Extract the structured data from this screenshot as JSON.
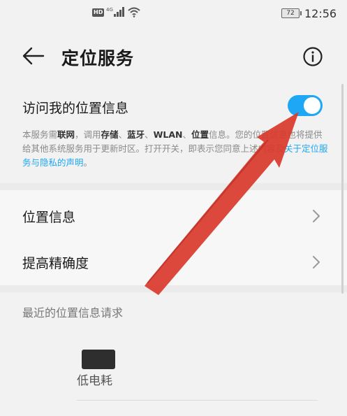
{
  "status_bar": {
    "hd": "HD",
    "network": "4G",
    "battery": "72",
    "time": "12:56"
  },
  "header": {
    "back_icon": "back-arrow-icon",
    "title": "定位服务",
    "info_icon": "info-icon"
  },
  "location_access": {
    "label": "访问我的位置信息",
    "enabled": true,
    "accent": "#1ea7f5"
  },
  "description": {
    "p1": "本服务需",
    "b1": "联网",
    "p2": "，调用",
    "b2": "存储",
    "p3": "、",
    "b3": "蓝牙",
    "p4": "、",
    "b4": "WLAN",
    "p5": "、",
    "b5": "位置",
    "p6": "信息。您的位置信息也将提供给其他系统服务用于更新时区。打开开关，即表示您同意上述内容及",
    "link": "关于定位服务与隐私的声明",
    "p7": "。"
  },
  "menu": [
    {
      "label": "位置信息",
      "icon": "chevron-right-icon"
    },
    {
      "label": "提高精确度",
      "icon": "chevron-right-icon"
    }
  ],
  "recent": {
    "title": "最近的位置信息请求",
    "items": [
      {
        "subtitle": "低电耗"
      }
    ]
  },
  "annotation": {
    "color": "#d93a2b"
  }
}
